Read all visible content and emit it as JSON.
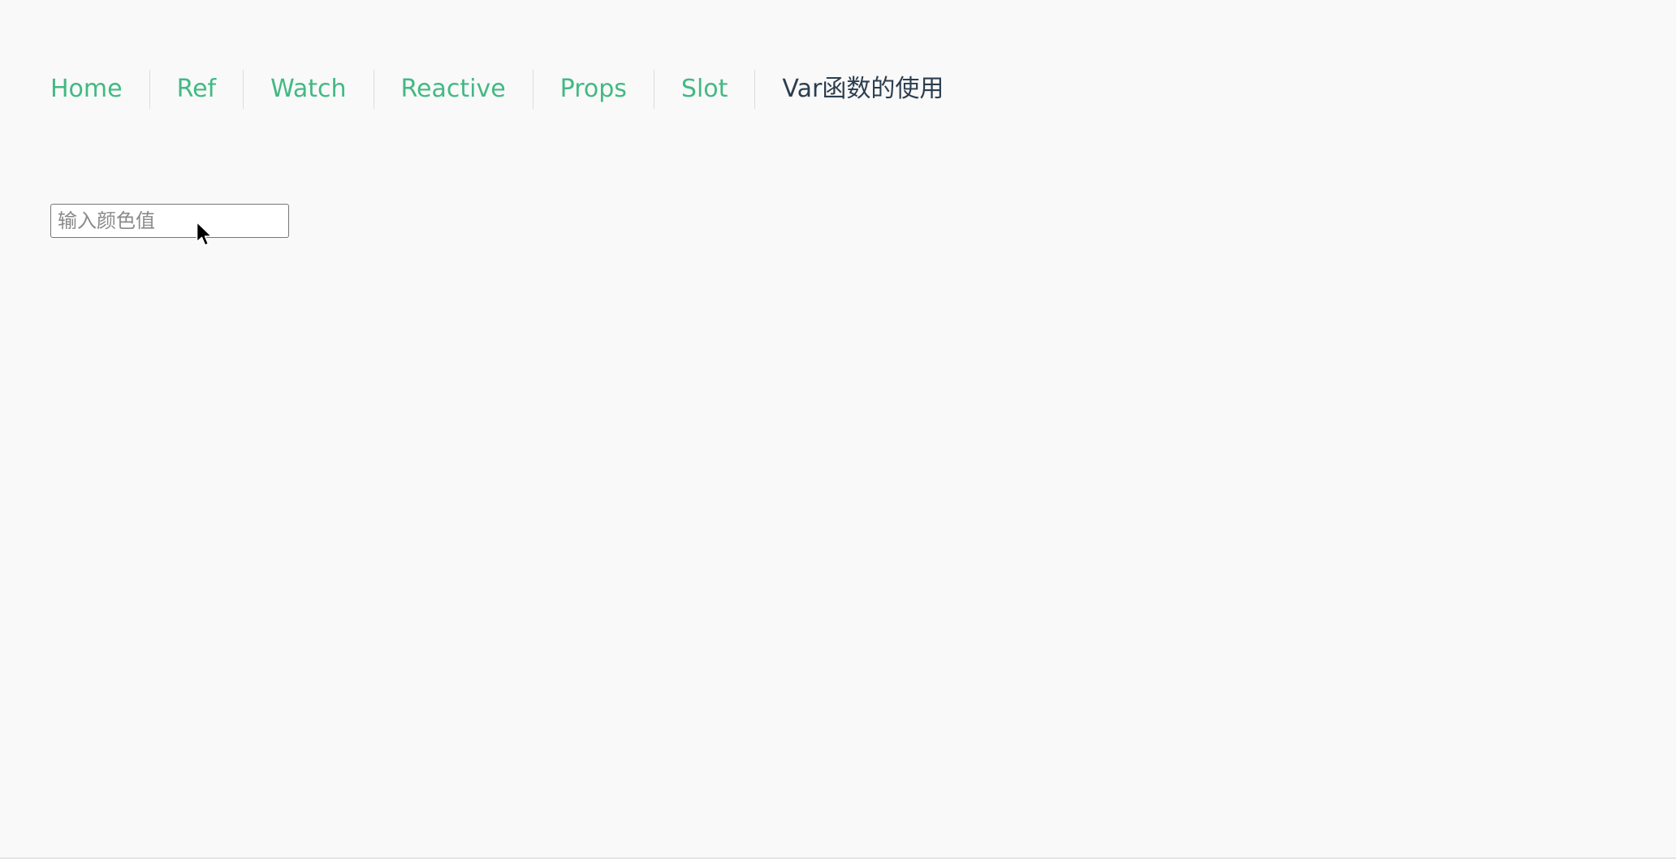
{
  "nav": {
    "items": [
      {
        "label": "Home",
        "active": false
      },
      {
        "label": "Ref",
        "active": false
      },
      {
        "label": "Watch",
        "active": false
      },
      {
        "label": "Reactive",
        "active": false
      },
      {
        "label": "Props",
        "active": false
      },
      {
        "label": "Slot",
        "active": false
      },
      {
        "label": "Var函数的使用",
        "active": true
      }
    ],
    "link_color": "#42b983",
    "active_color": "#2c3e50"
  },
  "color_input": {
    "placeholder": "输入颜色值",
    "value": ""
  },
  "cursor_icon": "mouse-pointer-icon"
}
